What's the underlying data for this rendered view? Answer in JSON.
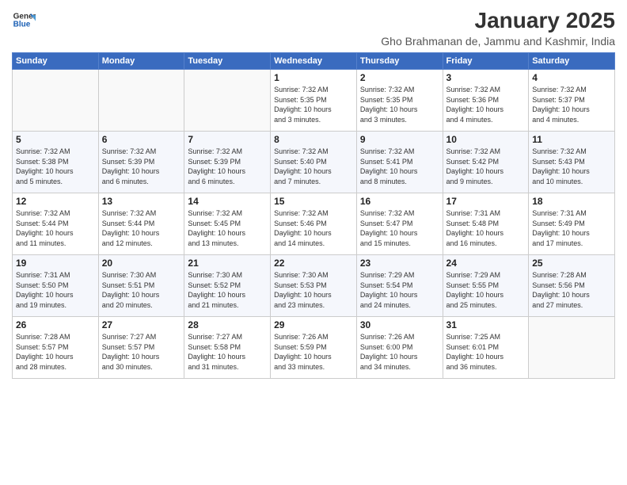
{
  "logo": {
    "line1": "General",
    "line2": "Blue"
  },
  "title": "January 2025",
  "location": "Gho Brahmanan de, Jammu and Kashmir, India",
  "weekdays": [
    "Sunday",
    "Monday",
    "Tuesday",
    "Wednesday",
    "Thursday",
    "Friday",
    "Saturday"
  ],
  "weeks": [
    [
      {
        "day": "",
        "info": ""
      },
      {
        "day": "",
        "info": ""
      },
      {
        "day": "",
        "info": ""
      },
      {
        "day": "1",
        "info": "Sunrise: 7:32 AM\nSunset: 5:35 PM\nDaylight: 10 hours\nand 3 minutes."
      },
      {
        "day": "2",
        "info": "Sunrise: 7:32 AM\nSunset: 5:35 PM\nDaylight: 10 hours\nand 3 minutes."
      },
      {
        "day": "3",
        "info": "Sunrise: 7:32 AM\nSunset: 5:36 PM\nDaylight: 10 hours\nand 4 minutes."
      },
      {
        "day": "4",
        "info": "Sunrise: 7:32 AM\nSunset: 5:37 PM\nDaylight: 10 hours\nand 4 minutes."
      }
    ],
    [
      {
        "day": "5",
        "info": "Sunrise: 7:32 AM\nSunset: 5:38 PM\nDaylight: 10 hours\nand 5 minutes."
      },
      {
        "day": "6",
        "info": "Sunrise: 7:32 AM\nSunset: 5:39 PM\nDaylight: 10 hours\nand 6 minutes."
      },
      {
        "day": "7",
        "info": "Sunrise: 7:32 AM\nSunset: 5:39 PM\nDaylight: 10 hours\nand 6 minutes."
      },
      {
        "day": "8",
        "info": "Sunrise: 7:32 AM\nSunset: 5:40 PM\nDaylight: 10 hours\nand 7 minutes."
      },
      {
        "day": "9",
        "info": "Sunrise: 7:32 AM\nSunset: 5:41 PM\nDaylight: 10 hours\nand 8 minutes."
      },
      {
        "day": "10",
        "info": "Sunrise: 7:32 AM\nSunset: 5:42 PM\nDaylight: 10 hours\nand 9 minutes."
      },
      {
        "day": "11",
        "info": "Sunrise: 7:32 AM\nSunset: 5:43 PM\nDaylight: 10 hours\nand 10 minutes."
      }
    ],
    [
      {
        "day": "12",
        "info": "Sunrise: 7:32 AM\nSunset: 5:44 PM\nDaylight: 10 hours\nand 11 minutes."
      },
      {
        "day": "13",
        "info": "Sunrise: 7:32 AM\nSunset: 5:44 PM\nDaylight: 10 hours\nand 12 minutes."
      },
      {
        "day": "14",
        "info": "Sunrise: 7:32 AM\nSunset: 5:45 PM\nDaylight: 10 hours\nand 13 minutes."
      },
      {
        "day": "15",
        "info": "Sunrise: 7:32 AM\nSunset: 5:46 PM\nDaylight: 10 hours\nand 14 minutes."
      },
      {
        "day": "16",
        "info": "Sunrise: 7:32 AM\nSunset: 5:47 PM\nDaylight: 10 hours\nand 15 minutes."
      },
      {
        "day": "17",
        "info": "Sunrise: 7:31 AM\nSunset: 5:48 PM\nDaylight: 10 hours\nand 16 minutes."
      },
      {
        "day": "18",
        "info": "Sunrise: 7:31 AM\nSunset: 5:49 PM\nDaylight: 10 hours\nand 17 minutes."
      }
    ],
    [
      {
        "day": "19",
        "info": "Sunrise: 7:31 AM\nSunset: 5:50 PM\nDaylight: 10 hours\nand 19 minutes."
      },
      {
        "day": "20",
        "info": "Sunrise: 7:30 AM\nSunset: 5:51 PM\nDaylight: 10 hours\nand 20 minutes."
      },
      {
        "day": "21",
        "info": "Sunrise: 7:30 AM\nSunset: 5:52 PM\nDaylight: 10 hours\nand 21 minutes."
      },
      {
        "day": "22",
        "info": "Sunrise: 7:30 AM\nSunset: 5:53 PM\nDaylight: 10 hours\nand 23 minutes."
      },
      {
        "day": "23",
        "info": "Sunrise: 7:29 AM\nSunset: 5:54 PM\nDaylight: 10 hours\nand 24 minutes."
      },
      {
        "day": "24",
        "info": "Sunrise: 7:29 AM\nSunset: 5:55 PM\nDaylight: 10 hours\nand 25 minutes."
      },
      {
        "day": "25",
        "info": "Sunrise: 7:28 AM\nSunset: 5:56 PM\nDaylight: 10 hours\nand 27 minutes."
      }
    ],
    [
      {
        "day": "26",
        "info": "Sunrise: 7:28 AM\nSunset: 5:57 PM\nDaylight: 10 hours\nand 28 minutes."
      },
      {
        "day": "27",
        "info": "Sunrise: 7:27 AM\nSunset: 5:57 PM\nDaylight: 10 hours\nand 30 minutes."
      },
      {
        "day": "28",
        "info": "Sunrise: 7:27 AM\nSunset: 5:58 PM\nDaylight: 10 hours\nand 31 minutes."
      },
      {
        "day": "29",
        "info": "Sunrise: 7:26 AM\nSunset: 5:59 PM\nDaylight: 10 hours\nand 33 minutes."
      },
      {
        "day": "30",
        "info": "Sunrise: 7:26 AM\nSunset: 6:00 PM\nDaylight: 10 hours\nand 34 minutes."
      },
      {
        "day": "31",
        "info": "Sunrise: 7:25 AM\nSunset: 6:01 PM\nDaylight: 10 hours\nand 36 minutes."
      },
      {
        "day": "",
        "info": ""
      }
    ]
  ]
}
